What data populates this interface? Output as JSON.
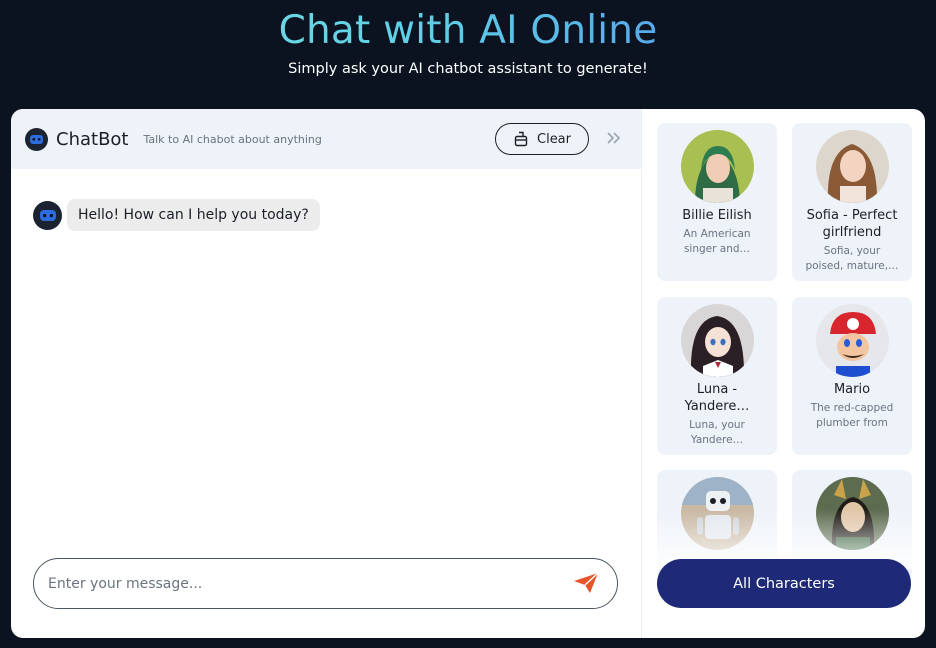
{
  "hero": {
    "title": "Chat with AI Online",
    "subtitle": "Simply ask your AI chatbot assistant to generate!"
  },
  "chat": {
    "title": "ChatBot",
    "tagline": "Talk to AI chabot about anything",
    "clear_label": "Clear",
    "messages": [
      {
        "sender": "bot",
        "text": "Hello! How can I help you today?"
      }
    ],
    "input_placeholder": "Enter your message...",
    "input_value": ""
  },
  "characters": {
    "items": [
      {
        "name": "Billie Eilish",
        "description": "An American singer and…"
      },
      {
        "name": "Sofia - Perfect girlfriend",
        "description": "Sofia, your poised, mature,…"
      },
      {
        "name": "Luna - Yandere…",
        "description": "Luna, your Yandere…"
      },
      {
        "name": "Mario",
        "description": "The red-capped plumber from th…"
      }
    ],
    "all_label": "All Characters"
  },
  "colors": {
    "accent": "#1e2a78",
    "send_icon": "#e8552c",
    "panel_bg": "#eef3f9",
    "page_bg": "#0b1220"
  }
}
